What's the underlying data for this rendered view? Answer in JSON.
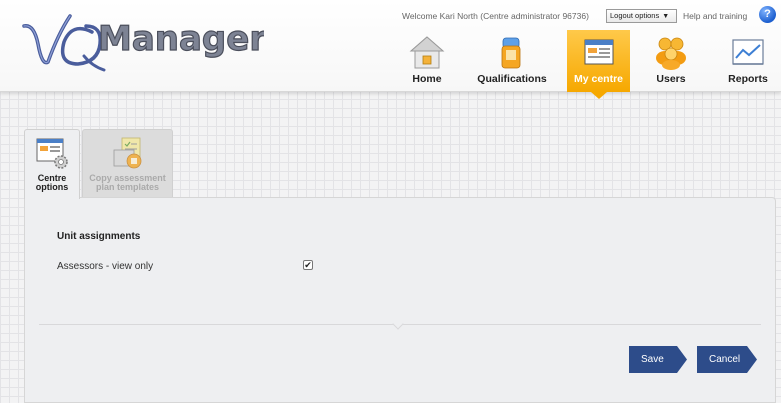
{
  "header": {
    "logo_text": "VQManager",
    "welcome_text": "Welcome Kari North (Centre administrator 96736)",
    "logout_label": "Logout options",
    "help_label": "Help and training",
    "help_icon_glyph": "?"
  },
  "nav": {
    "items": [
      {
        "label": "Home",
        "icon": "home-icon"
      },
      {
        "label": "Qualifications",
        "icon": "qualifications-icon"
      },
      {
        "label": "My centre",
        "icon": "my-centre-icon",
        "active": true
      },
      {
        "label": "Users",
        "icon": "users-icon"
      },
      {
        "label": "Reports",
        "icon": "reports-icon"
      }
    ],
    "active_color": "#f6a800"
  },
  "tabs": [
    {
      "label": "Centre options",
      "active": true
    },
    {
      "label": "Copy assessment plan templates",
      "active": false
    }
  ],
  "form": {
    "section_title": "Unit assignments",
    "fields": [
      {
        "label": "Assessors - view only",
        "checked": true,
        "check_glyph": "✔"
      }
    ]
  },
  "actions": {
    "save_label": "Save",
    "cancel_label": "Cancel",
    "button_color": "#2d4c8a"
  }
}
